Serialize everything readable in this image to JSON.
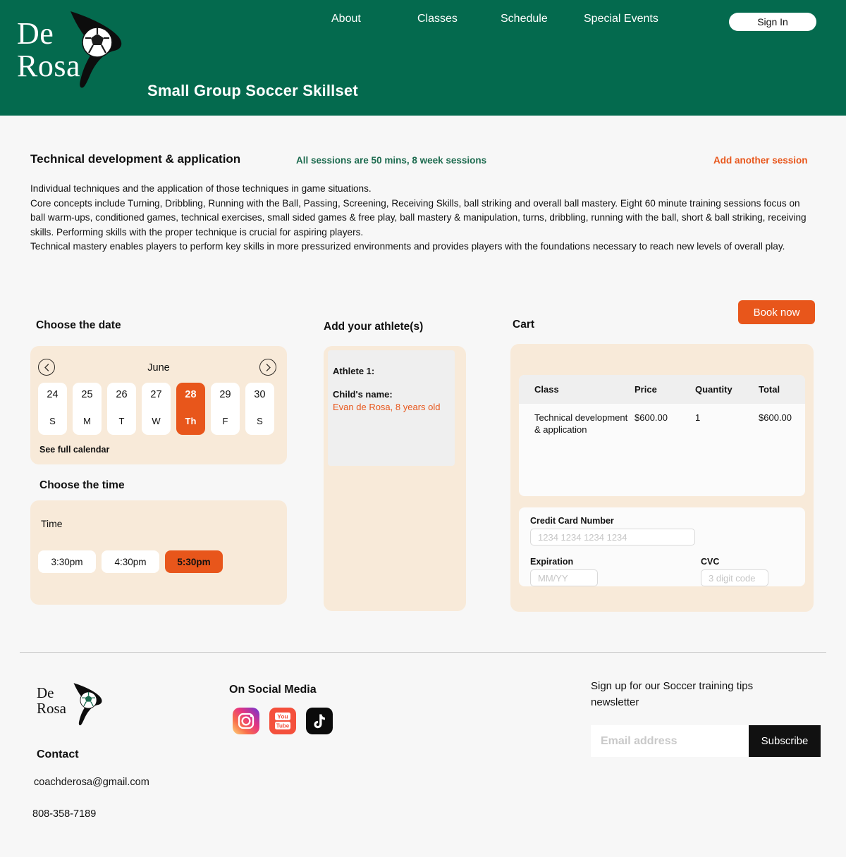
{
  "brand": {
    "logo_line1": "De",
    "logo_line2": "Rosa",
    "logo_icon": "soccer-ball-swoosh-logo",
    "green": "#046a4e",
    "orange": "#e8561b",
    "cream": "#f8ead9"
  },
  "header": {
    "nav": [
      {
        "label": "About"
      },
      {
        "label": "Classes"
      },
      {
        "label": "Schedule"
      },
      {
        "label": "Special Events"
      }
    ],
    "sign_in_label": "Sign In",
    "page_title": "Small Group Soccer Skillset"
  },
  "description": {
    "title": "Technical development & application",
    "subtitle": "All sessions are 50 mins, 8 week sessions",
    "add_session_label": "Add another session",
    "paragraphs": [
      "Individual techniques and the application of those techniques in game situations.",
      "Core concepts include Turning, Dribbling, Running with the Ball, Passing, Screening, Receiving Skills, ball striking and overall ball mastery. Eight 60 minute training sessions focus on ball warm-ups, conditioned games, technical exercises, small sided games & free play, ball mastery & manipulation, turns, dribbling, running with the ball, short & ball striking, receiving skills. Performing skills with the proper technique is crucial for aspiring players.",
      "Technical mastery enables players to perform key skills in more pressurized environments and provides players with the foundations necessary to reach new levels of overall play."
    ]
  },
  "date_picker": {
    "heading": "Choose the date",
    "month": "June",
    "prev_icon": "chevron-left-icon",
    "next_icon": "chevron-right-icon",
    "days": [
      {
        "number": "24",
        "weekday": "S",
        "selected": false
      },
      {
        "number": "25",
        "weekday": "M",
        "selected": false
      },
      {
        "number": "26",
        "weekday": "T",
        "selected": false
      },
      {
        "number": "27",
        "weekday": "W",
        "selected": false
      },
      {
        "number": "28",
        "weekday": "Th",
        "selected": true
      },
      {
        "number": "29",
        "weekday": "F",
        "selected": false
      },
      {
        "number": "30",
        "weekday": "S",
        "selected": false
      }
    ],
    "see_full_calendar_label": "See full calendar"
  },
  "time_picker": {
    "heading": "Choose the time",
    "label": "Time",
    "slots": [
      {
        "label": "3:30pm",
        "selected": false
      },
      {
        "label": "4:30pm",
        "selected": false
      },
      {
        "label": "5:30pm",
        "selected": true
      }
    ]
  },
  "athletes": {
    "heading": "Add your athlete(s)",
    "athlete_label": "Athlete 1:",
    "child_name_label": "Child's name:",
    "child_name_value": "Evan de Rosa, 8 years old"
  },
  "cart": {
    "heading": "Cart",
    "book_now_label": "Book now",
    "columns": [
      "Class",
      "Price",
      "Quantity",
      "Total"
    ],
    "rows": [
      {
        "class": "Technical development & application",
        "price": "$600.00",
        "quantity": "1",
        "total": "$600.00"
      }
    ],
    "payment": {
      "card_label": "Credit Card Number",
      "card_placeholder": "1234 1234 1234 1234",
      "card_value": "",
      "expiration_label": "Expiration",
      "expiration_placeholder": "MM/YY",
      "expiration_value": "",
      "cvc_label": "CVC",
      "cvc_placeholder": "3 digit code",
      "cvc_value": ""
    }
  },
  "footer": {
    "contact_heading": "Contact",
    "email": "coachderosa@gmail.com",
    "phone": "808-358-7189",
    "social_heading": "On Social Media",
    "social": [
      {
        "name": "instagram-icon"
      },
      {
        "name": "youtube-icon"
      },
      {
        "name": "tiktok-icon"
      }
    ],
    "newsletter_text": "Sign up for our Soccer training tips newsletter",
    "email_placeholder": "Email address",
    "email_value": "",
    "subscribe_label": "Subscribe"
  }
}
